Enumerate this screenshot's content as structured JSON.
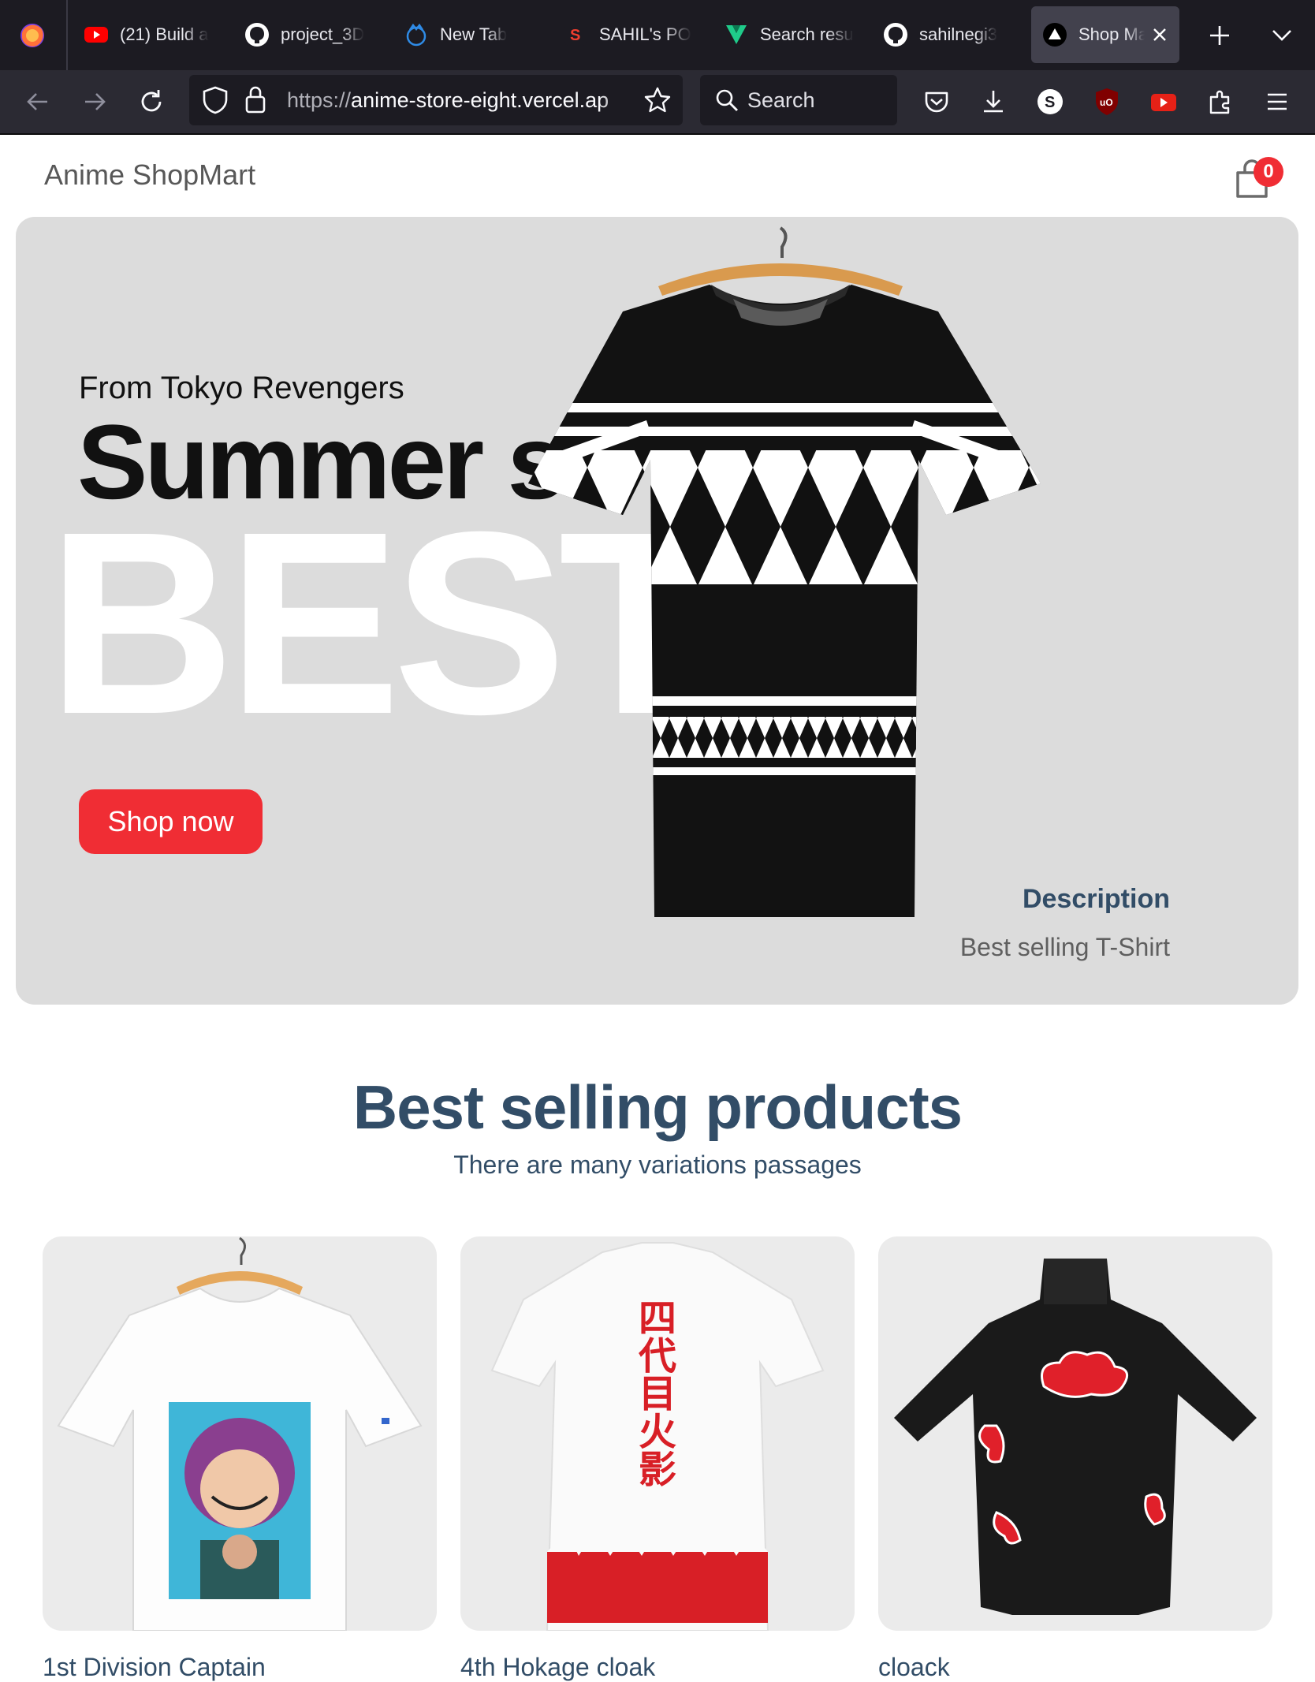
{
  "browser": {
    "tabs": [
      {
        "label": "(21) Build a",
        "icon": "youtube-icon"
      },
      {
        "label": "project_3D",
        "icon": "github-icon"
      },
      {
        "label": "New Tab",
        "icon": "firefox-blue-icon"
      },
      {
        "label": "SAHIL's PO",
        "icon": "sanity-icon"
      },
      {
        "label": "Search resu",
        "icon": "vuetify-icon"
      },
      {
        "label": "sahilnegi3",
        "icon": "github-icon"
      },
      {
        "label": "Shop Ma",
        "icon": "vercel-icon",
        "active": true
      }
    ],
    "url_scheme": "https://",
    "url_host": "anime-store-eight.vercel.ap",
    "search_placeholder": "Search"
  },
  "header": {
    "logo": "Anime ShopMart",
    "cart_count": "0"
  },
  "hero": {
    "small_text": "From Tokyo Revengers",
    "mid_text": "Summer s",
    "large_text": "BEST",
    "button_label": "Shop now",
    "desc_title": "Description",
    "desc_text": "Best selling T-Shirt"
  },
  "products_section": {
    "title": "Best selling products",
    "subtitle": "There are many variations passages",
    "items": [
      {
        "name": "1st Division Captain"
      },
      {
        "name": "4th Hokage cloak"
      },
      {
        "name": "cloack"
      }
    ]
  },
  "colors": {
    "accent": "#f02d34",
    "heading": "#324d67",
    "hero_bg": "#dcdcdc",
    "card_bg": "#ebebeb"
  }
}
